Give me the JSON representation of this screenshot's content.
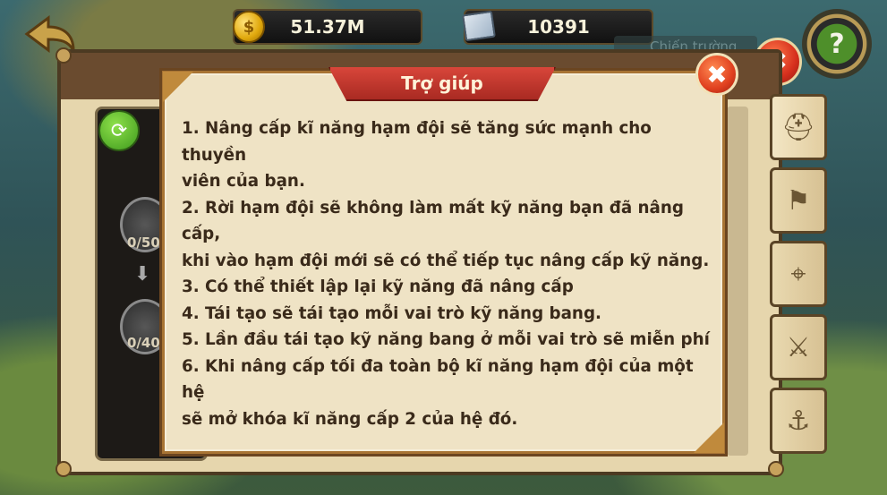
{
  "hud": {
    "gold_value": "51.37M",
    "map_value": "10391",
    "background_label": "Chiến trường",
    "help_icon": "?"
  },
  "side_panel": {
    "skill1_progress": "0/50",
    "skill2_progress": "0/40"
  },
  "tabs": [
    "helmet-icon",
    "pirate-flag-icon",
    "target-icon",
    "sword-icon",
    "anchor-icon"
  ],
  "dialog": {
    "title": "Trợ giúp",
    "lines": [
      "1. Nâng cấp kĩ năng hạm đội sẽ tăng sức mạnh cho thuyền",
      "viên của bạn.",
      "2. Rời hạm đội sẽ không làm mất kỹ năng bạn đã nâng cấp,",
      "khi vào hạm đội mới sẽ có thể tiếp tục nâng cấp kỹ năng.",
      "3. Có thể thiết lập lại kỹ năng đã nâng cấp",
      "4. Tái tạo sẽ tái tạo mỗi vai trò kỹ năng bang.",
      "5. Lần đầu tái tạo kỹ năng bang ở mỗi vai trò sẽ miễn phí",
      "6. Khi nâng cấp tối đa toàn bộ kĩ năng hạm đội của một hệ",
      "sẽ mở khóa kĩ năng cấp 2 của hệ đó."
    ]
  },
  "colors": {
    "ribbon": "#c2372c",
    "parchment": "#efe3c5",
    "text": "#3a2a1a"
  }
}
